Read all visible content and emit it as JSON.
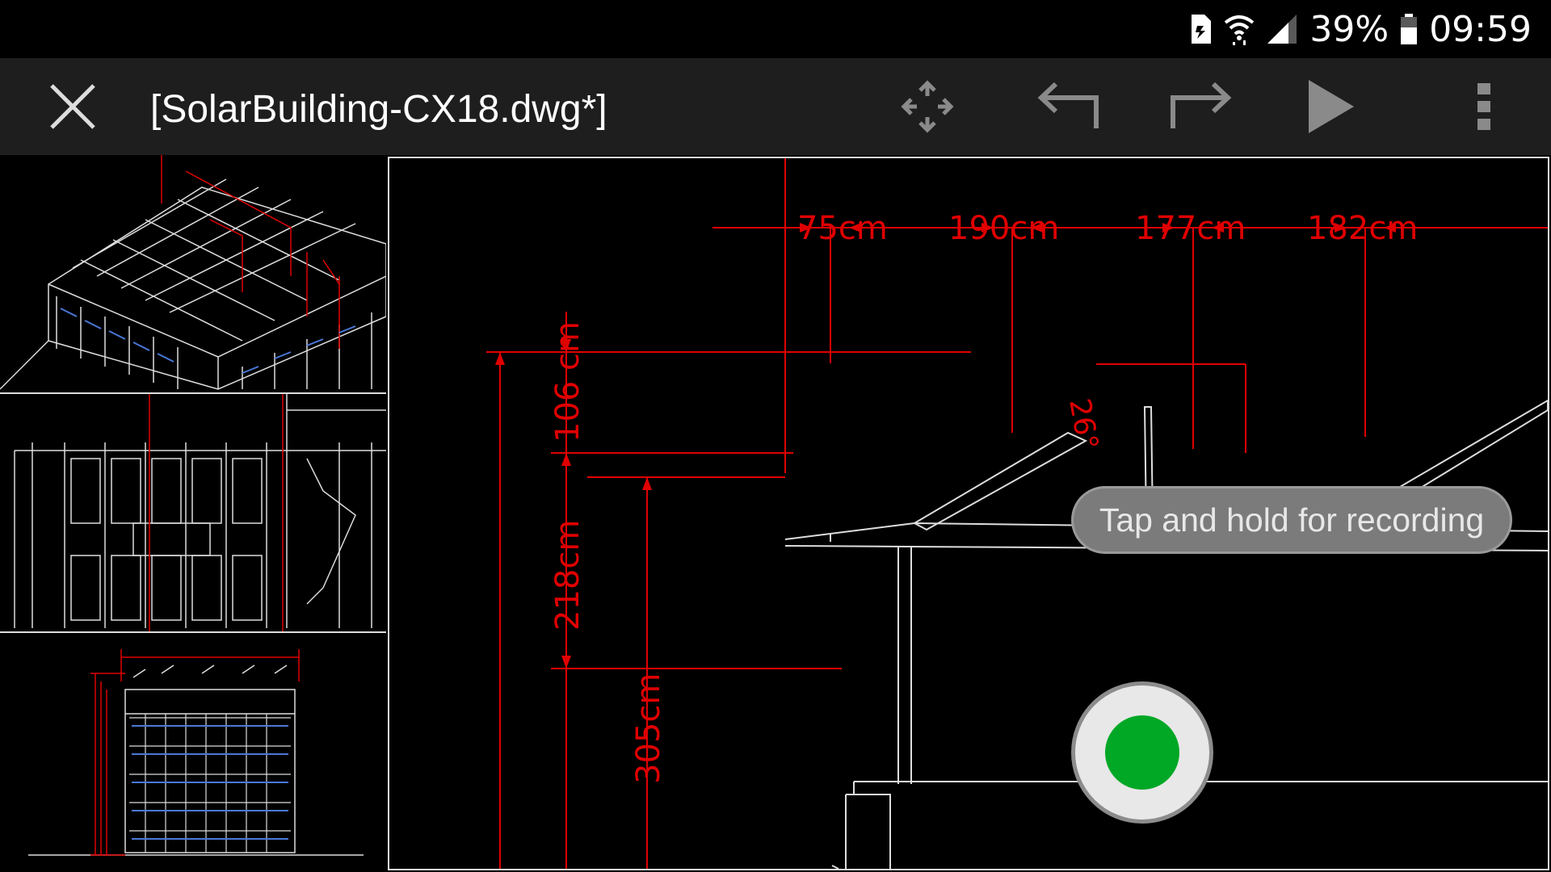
{
  "status_bar": {
    "battery_percent": "39%",
    "time": "09:59",
    "icons": [
      "sim-card-icon",
      "wifi-icon",
      "signal-icon",
      "battery-icon"
    ]
  },
  "toolbar": {
    "close_icon": "close-icon",
    "file_title": "[SolarBuilding-CX18.dwg*]",
    "pan_icon": "pan-move-icon",
    "undo_icon": "undo-icon",
    "redo_icon": "redo-icon",
    "play_icon": "play-icon",
    "overflow_icon": "more-vert-icon"
  },
  "drawing": {
    "dimensions": {
      "top_1": "75cm",
      "top_2": "190cm",
      "top_3": "177cm",
      "top_4": "182cm",
      "vertical_1": "106 cm",
      "vertical_2": "218cm",
      "vertical_3": "305cm",
      "angle": "26°"
    }
  },
  "recording": {
    "tooltip": "Tap and hold for recording",
    "button_icon": "record-icon"
  },
  "colors": {
    "accent_red": "#e00000",
    "record_green": "#00a826"
  }
}
